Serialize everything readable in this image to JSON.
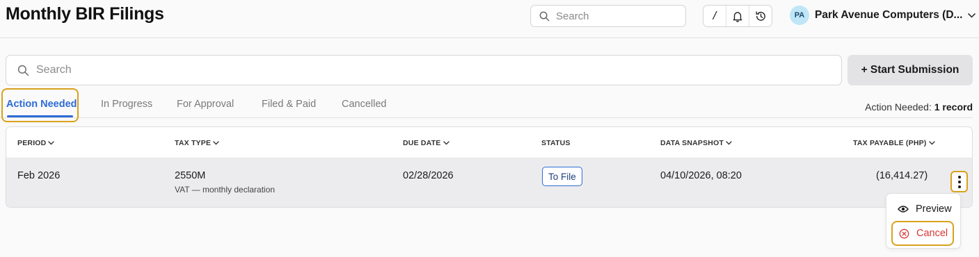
{
  "header": {
    "title": "Monthly BIR Filings",
    "search_placeholder": "Search",
    "shortcut_label": "/",
    "org_initials": "PA",
    "org_name": "Park Avenue Computers (D..."
  },
  "toolbar": {
    "search_placeholder": "Search",
    "start_button_label": "+ Start Submission"
  },
  "tabs": [
    {
      "label": "Action Needed",
      "active": true
    },
    {
      "label": "In Progress",
      "active": false
    },
    {
      "label": "For Approval",
      "active": false
    },
    {
      "label": "Filed & Paid",
      "active": false
    },
    {
      "label": "Cancelled",
      "active": false
    }
  ],
  "record_summary": {
    "prefix": "Action Needed:",
    "count_text": "1 record"
  },
  "table": {
    "columns": [
      {
        "label": "PERIOD",
        "sortable": true
      },
      {
        "label": "TAX TYPE",
        "sortable": true
      },
      {
        "label": "DUE DATE",
        "sortable": true
      },
      {
        "label": "STATUS",
        "sortable": false
      },
      {
        "label": "DATA SNAPSHOT",
        "sortable": true
      },
      {
        "label": "TAX PAYABLE (PHP)",
        "sortable": true
      }
    ],
    "rows": [
      {
        "period": "Feb 2026",
        "tax_type": "2550M",
        "tax_type_desc": "VAT — monthly declaration",
        "due_date": "02/28/2026",
        "status": "To File",
        "data_snapshot": "04/10/2026, 08:20",
        "tax_payable": "(16,414.27)"
      }
    ]
  },
  "row_menu": {
    "items": [
      {
        "label": "Preview",
        "icon": "eye-icon"
      },
      {
        "label": "Cancel",
        "icon": "x-circle-icon"
      }
    ]
  },
  "colors": {
    "accent": "#2d6bd6",
    "highlight": "#d9a11c",
    "danger": "#d93636",
    "avatar_bg": "#bfe6f7"
  }
}
